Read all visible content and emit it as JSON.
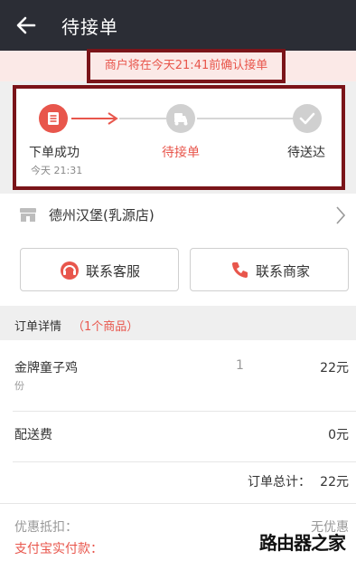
{
  "header": {
    "title": "待接单",
    "back_icon": "back-arrow-icon"
  },
  "notice": {
    "text": "商户将在今天21:41前确认接单"
  },
  "steps": [
    {
      "label": "下单成功",
      "time": "今天 21:31",
      "icon": "order-list-icon",
      "state": "done"
    },
    {
      "label": "待接单",
      "icon": "delivery-scooter-icon",
      "state": "current"
    },
    {
      "label": "待送达",
      "icon": "checkmark-icon",
      "state": "pending"
    }
  ],
  "store": {
    "name": "德州汉堡(乳源店)",
    "icon": "store-icon"
  },
  "actions": {
    "contact_service": "联系客服",
    "contact_merchant": "联系商家"
  },
  "details": {
    "title": "订单详情",
    "count": "（1个商品）",
    "item_name": "金牌童子鸡",
    "item_unit": "份",
    "item_qty": "1",
    "item_price": "22元",
    "delivery_label": "配送费",
    "delivery_fee": "0元",
    "total_label": "订单总计：",
    "total_value": "22元",
    "discount_label": "优惠抵扣：",
    "discount_value": "无优惠",
    "paid_label": "支付宝实付款："
  },
  "watermark": "路由器之家",
  "colors": {
    "accent": "#e8564c",
    "header_bg": "#2b2d35",
    "highlight_border": "#7a1419"
  }
}
